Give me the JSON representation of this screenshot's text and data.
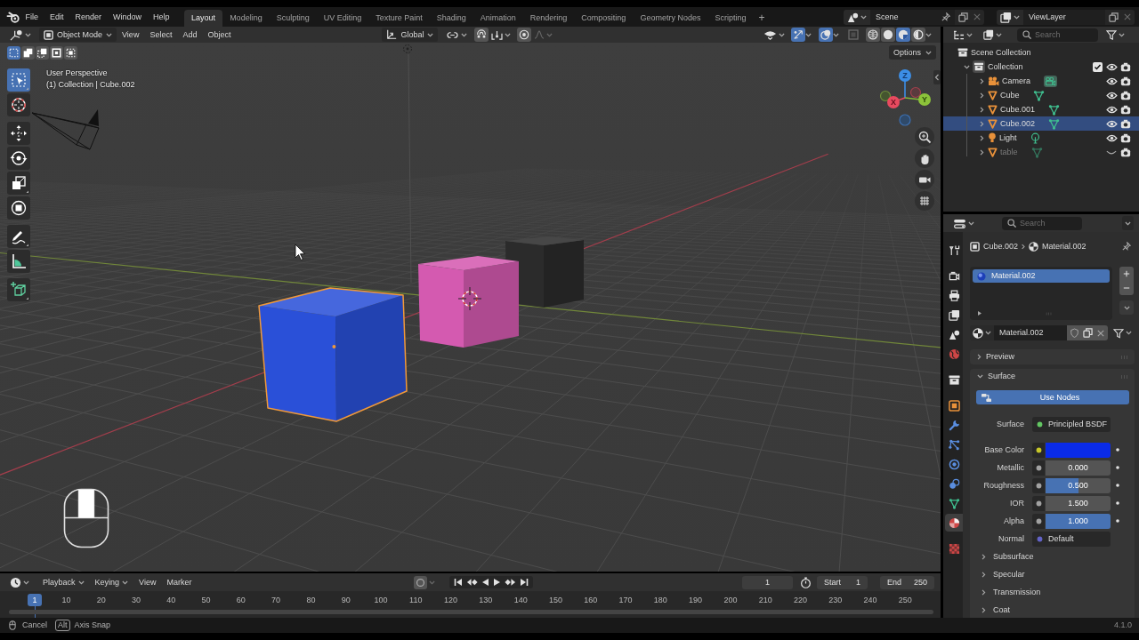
{
  "menu_bar": {
    "menus": [
      "File",
      "Edit",
      "Render",
      "Window",
      "Help"
    ],
    "workspaces": [
      {
        "label": "Layout",
        "selected": true
      },
      {
        "label": "Modeling",
        "selected": false
      },
      {
        "label": "Sculpting",
        "selected": false
      },
      {
        "label": "UV Editing",
        "selected": false
      },
      {
        "label": "Texture Paint",
        "selected": false
      },
      {
        "label": "Shading",
        "selected": false
      },
      {
        "label": "Animation",
        "selected": false
      },
      {
        "label": "Rendering",
        "selected": false
      },
      {
        "label": "Compositing",
        "selected": false
      },
      {
        "label": "Geometry Nodes",
        "selected": false
      },
      {
        "label": "Scripting",
        "selected": false
      }
    ],
    "add_workspace": "+",
    "scene": "Scene",
    "view_layer": "ViewLayer"
  },
  "viewport": {
    "header": {
      "mode": "Object Mode",
      "menus": [
        "View",
        "Select",
        "Add",
        "Object"
      ],
      "orientation": "Global",
      "toggles": [
        {
          "kind": "snap",
          "on": false
        },
        {
          "kind": "proportional",
          "on": false
        },
        {
          "kind": "gizmos",
          "on": true
        },
        {
          "kind": "overlays",
          "on": true
        },
        {
          "kind": "xray",
          "on": false
        }
      ],
      "shading": [
        {
          "kind": "wireframe",
          "selected": false
        },
        {
          "kind": "solid",
          "selected": false
        },
        {
          "kind": "material",
          "selected": true
        },
        {
          "kind": "rendered",
          "selected": false
        }
      ]
    },
    "select_modes": [
      {
        "kind": "set",
        "selected": true
      },
      {
        "kind": "extend",
        "selected": false
      },
      {
        "kind": "subtract",
        "selected": false
      },
      {
        "kind": "invert",
        "selected": false
      },
      {
        "kind": "intersect",
        "selected": false
      }
    ],
    "options": "Options",
    "tools": [
      {
        "kind": "select_box",
        "selected": true
      },
      {
        "kind": "cursor",
        "selected": false
      },
      {
        "kind": "move",
        "selected": false
      },
      {
        "kind": "rotate",
        "selected": false
      },
      {
        "kind": "scale",
        "selected": false
      },
      {
        "kind": "transform",
        "selected": false
      },
      {
        "kind": "annotate",
        "selected": false
      },
      {
        "kind": "measure",
        "selected": false
      },
      {
        "kind": "add_cube",
        "selected": false
      }
    ],
    "info": [
      "User Perspective",
      "(1) Collection | Cube.002"
    ],
    "gizmo_axes": [
      "Z",
      "X",
      "Y"
    ],
    "objects": [
      {
        "kind": "light",
        "selected": false
      },
      {
        "kind": "camera",
        "selected": false
      },
      {
        "kind": "cube",
        "color": "#2b2b2b",
        "selected": false
      },
      {
        "kind": "cube",
        "color": "#d45ab0",
        "selected": false
      },
      {
        "kind": "cube",
        "color": "#2a50d8",
        "selected": true
      }
    ]
  },
  "timeline": {
    "dropdowns": [
      "Playback",
      "Keying"
    ],
    "menus": [
      "View",
      "Marker"
    ],
    "current_frame": "1",
    "start": {
      "label": "Start",
      "value": "1"
    },
    "end": {
      "label": "End",
      "value": "250"
    },
    "ruler": {
      "current": "1",
      "ticks": [
        "10",
        "20",
        "30",
        "40",
        "50",
        "60",
        "70",
        "80",
        "90",
        "100",
        "110",
        "120",
        "130",
        "140",
        "150",
        "160",
        "170",
        "180",
        "190",
        "200",
        "210",
        "220",
        "230",
        "240",
        "250"
      ]
    }
  },
  "outliner": {
    "search": {
      "placeholder": "Search"
    },
    "tree": [
      {
        "label": "Scene Collection",
        "kind": "scene_collection",
        "selected": false,
        "children": [
          {
            "label": "Collection",
            "kind": "collection",
            "expanded": true,
            "selected": false,
            "checked": true,
            "visible": true,
            "children": [
              {
                "label": "Camera",
                "kind": "camera",
                "expanded": false,
                "selected": false,
                "visible": true
              },
              {
                "label": "Cube",
                "kind": "mesh",
                "expanded": false,
                "selected": false,
                "visible": true
              },
              {
                "label": "Cube.001",
                "kind": "mesh",
                "expanded": false,
                "selected": false,
                "visible": true
              },
              {
                "label": "Cube.002",
                "kind": "mesh",
                "expanded": false,
                "selected": true,
                "visible": true
              },
              {
                "label": "Light",
                "kind": "light",
                "expanded": false,
                "selected": false,
                "visible": true
              },
              {
                "label": "table",
                "kind": "mesh",
                "expanded": false,
                "selected": false,
                "visible": false
              }
            ]
          }
        ]
      }
    ]
  },
  "properties": {
    "search": {
      "placeholder": "Search"
    },
    "tabs": [
      {
        "kind": "tool",
        "selected": false
      },
      {
        "kind": "render",
        "selected": false
      },
      {
        "kind": "output",
        "selected": false
      },
      {
        "kind": "view_layer",
        "selected": false
      },
      {
        "kind": "scene",
        "selected": false
      },
      {
        "kind": "world",
        "selected": false
      },
      {
        "kind": "collection",
        "selected": false
      },
      {
        "kind": "object",
        "selected": false
      },
      {
        "kind": "modifiers",
        "selected": false
      },
      {
        "kind": "particles",
        "selected": false
      },
      {
        "kind": "physics",
        "selected": false
      },
      {
        "kind": "constraints",
        "selected": false
      },
      {
        "kind": "data",
        "selected": false
      },
      {
        "kind": "material",
        "selected": true
      },
      {
        "kind": "texture",
        "selected": false
      }
    ],
    "breadcrumb": [
      "Cube.002",
      "Material.002"
    ],
    "slots": [
      {
        "label": "Material.002",
        "selected": true
      }
    ],
    "material": "Material.002",
    "panels": [
      {
        "label": "Preview",
        "expanded": false
      },
      {
        "label": "Surface",
        "expanded": true,
        "use_nodes": "Use Nodes",
        "fields": [
          {
            "label": "Surface",
            "kind": "socket",
            "socket": {
              "color": "#63c763"
            },
            "value": "Principled BSDF"
          },
          {
            "label": "Base Color",
            "kind": "color",
            "socket": {
              "color": "#c7c729"
            },
            "color": "#0a2be8"
          },
          {
            "label": "Metallic",
            "kind": "slider",
            "socket": {
              "color": "#a1a1a1"
            },
            "value": "0.000",
            "level": 0
          },
          {
            "label": "Roughness",
            "kind": "slider",
            "socket": {
              "color": "#a1a1a1"
            },
            "value": "0.500",
            "level": 0.5
          },
          {
            "label": "IOR",
            "kind": "number",
            "socket": {
              "color": "#a1a1a1"
            },
            "value": "1.500"
          },
          {
            "label": "Alpha",
            "kind": "slider",
            "socket": {
              "color": "#a1a1a1"
            },
            "value": "1.000",
            "level": 1
          },
          {
            "label": "Normal",
            "kind": "socket",
            "socket": {
              "color": "#6363c7"
            },
            "value": "Default"
          }
        ],
        "subpanels": [
          {
            "label": "Subsurface",
            "expanded": false
          },
          {
            "label": "Specular",
            "expanded": false
          },
          {
            "label": "Transmission",
            "expanded": false
          },
          {
            "label": "Coat",
            "expanded": false
          }
        ]
      }
    ]
  },
  "status_bar": {
    "hints": [
      {
        "kind": "mouse",
        "label": "Cancel"
      },
      {
        "kind": "key",
        "key": "Alt",
        "label": "Axis Snap"
      }
    ],
    "version": "4.1.0"
  }
}
